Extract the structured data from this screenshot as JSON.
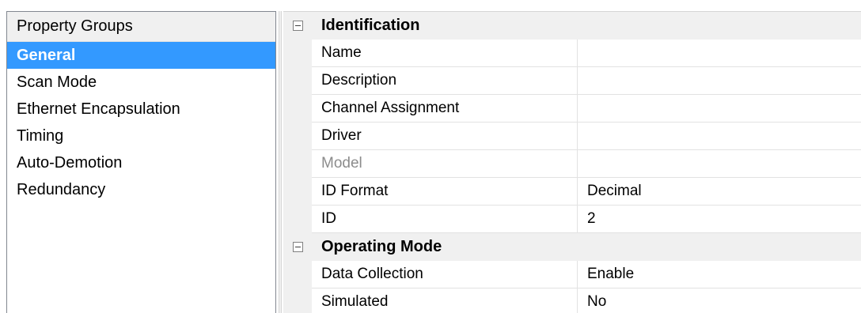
{
  "property_groups": {
    "header": "Property Groups",
    "items": [
      {
        "label": "General",
        "selected": true
      },
      {
        "label": "Scan Mode"
      },
      {
        "label": "Ethernet Encapsulation"
      },
      {
        "label": "Timing"
      },
      {
        "label": "Auto-Demotion"
      },
      {
        "label": "Redundancy"
      }
    ]
  },
  "categories": [
    {
      "title": "Identification",
      "rows": [
        {
          "name": "Name",
          "value": ""
        },
        {
          "name": "Description",
          "value": ""
        },
        {
          "name": "Channel Assignment",
          "value": ""
        },
        {
          "name": "Driver",
          "value": ""
        },
        {
          "name": "Model",
          "value": "",
          "disabled": true
        },
        {
          "name": "ID Format",
          "value": "Decimal"
        },
        {
          "name": "ID",
          "value": "2"
        }
      ]
    },
    {
      "title": "Operating Mode",
      "rows": [
        {
          "name": "Data Collection",
          "value": "Enable"
        },
        {
          "name": "Simulated",
          "value": "No"
        }
      ]
    }
  ],
  "colors": {
    "selection": "#3399ff",
    "header_bg": "#f0f0f0",
    "disabled_text": "#8c8c8c"
  }
}
